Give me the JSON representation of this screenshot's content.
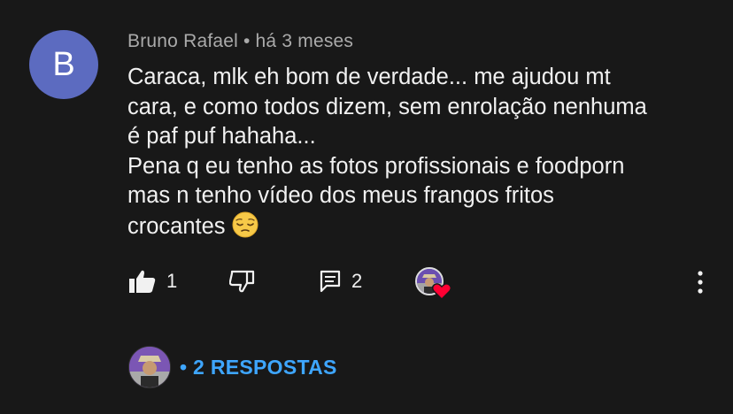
{
  "comment": {
    "avatar_letter": "B",
    "avatar_color": "#5c6bc0",
    "author": "Bruno Rafael",
    "separator": "•",
    "time": "há 3 meses",
    "lines": [
      "Caraca, mlk eh bom de verdade... me ajudou mt",
      "cara, e como todos dizem, sem enrolação nenhuma",
      "é paf puf hahaha...",
      "Pena q eu tenho as fotos profissionais e foodporn",
      "mas n tenho vídeo dos meus frangos fritos",
      "crocantes"
    ],
    "emoji": "pensive-face"
  },
  "actions": {
    "like_count": "1",
    "reply_count": "2",
    "icons": [
      "thumbs-up-icon",
      "thumbs-down-icon",
      "reply-icon",
      "creator-heart-icon",
      "more-vert-icon"
    ]
  },
  "replies": {
    "label": "• 2 RESPOSTAS",
    "accent": "#3ea6ff"
  }
}
